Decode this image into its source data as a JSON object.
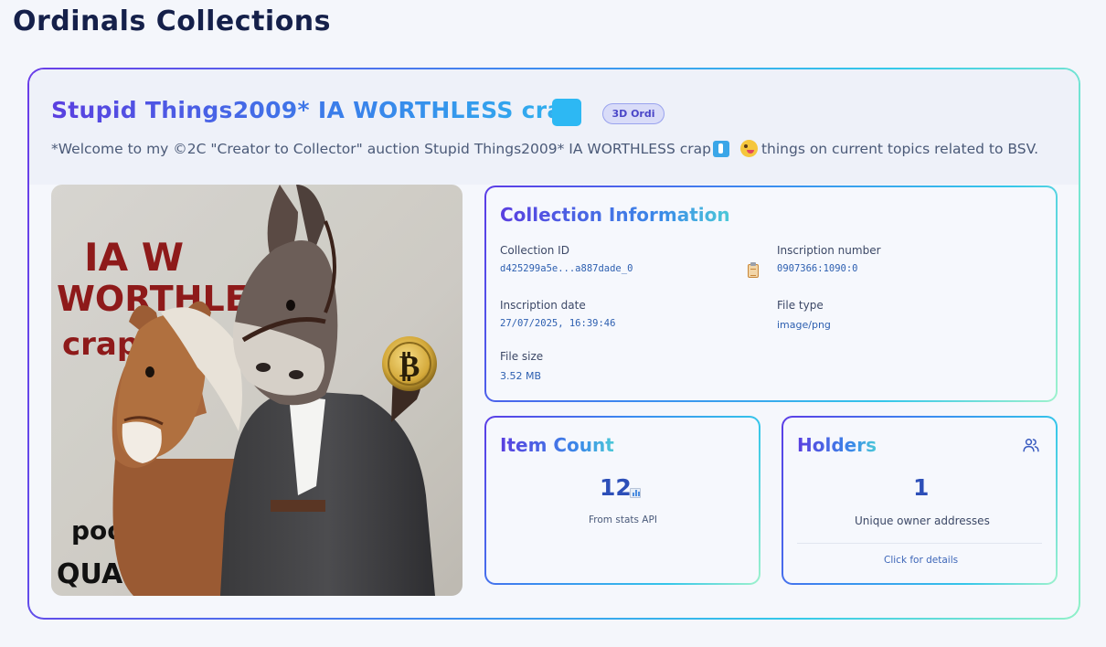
{
  "page": {
    "title": "Ordinals Collections"
  },
  "collection": {
    "name": "Stupid Things2009* IA WORTHLESS crap",
    "badge": "3D Ordi",
    "description_part1": "*Welcome to my ©2C \"Creator to Collector\" auction Stupid Things2009* IA WORTHLESS crap",
    "description_part2": "things on current topics related to BSV.",
    "image": {
      "text_top_line1": "IA W",
      "text_top_line2": "WORTHLESS",
      "text_top_line3": "crap",
      "text_top_exclaim": "!",
      "text_bottom_line1": "poor",
      "text_bottom_line2": "QUALITY!",
      "coin_symbol": "₿"
    }
  },
  "info": {
    "title": "Collection Information",
    "collection_id_label": "Collection ID",
    "collection_id_value": "d425299a5e...a887dade_0",
    "inscription_number_label": "Inscription number",
    "inscription_number_value": "0907366:1090:0",
    "inscription_date_label": "Inscription date",
    "inscription_date_value": "27/07/2025, 16:39:46",
    "file_type_label": "File type",
    "file_type_value": "image/png",
    "file_size_label": "File size",
    "file_size_value": "3.52 MB"
  },
  "item_count": {
    "title": "Item Count",
    "value": "12",
    "caption": "From stats API"
  },
  "holders": {
    "title": "Holders",
    "value": "1",
    "caption": "Unique owner addresses",
    "link": "Click for details"
  },
  "colors": {
    "accent_purple": "#5a3fe0",
    "accent_blue": "#3a8ae8",
    "accent_cyan": "#33c9ea",
    "accent_mint": "#8ff0c8"
  },
  "icons": {
    "title_square": "blue-square-icon",
    "emoji_1": "accessibility-emoji-icon",
    "emoji_2": "zany-face-emoji-icon",
    "copy": "clipboard-icon",
    "stats": "bar-chart-icon",
    "holders": "users-icon"
  }
}
